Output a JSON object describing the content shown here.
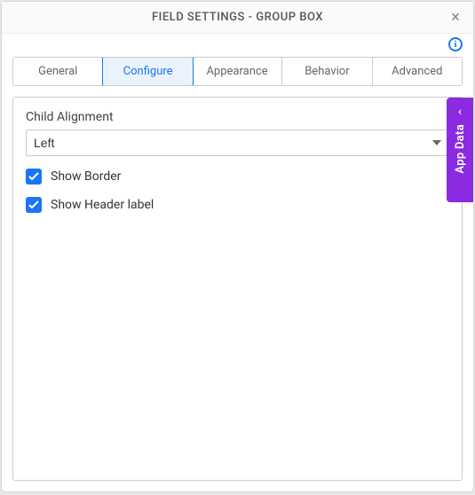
{
  "header": {
    "title": "FIELD SETTINGS - GROUP BOX"
  },
  "tabs": {
    "items": [
      {
        "label": "General"
      },
      {
        "label": "Configure"
      },
      {
        "label": "Appearance"
      },
      {
        "label": "Behavior"
      },
      {
        "label": "Advanced"
      }
    ],
    "active_index": 1
  },
  "configure": {
    "child_alignment_label": "Child Alignment",
    "child_alignment_value": "Left",
    "show_border_label": "Show Border",
    "show_border_checked": true,
    "show_header_label": "Show Header label",
    "show_header_checked": true
  },
  "side_tab": {
    "label": "App Data"
  }
}
